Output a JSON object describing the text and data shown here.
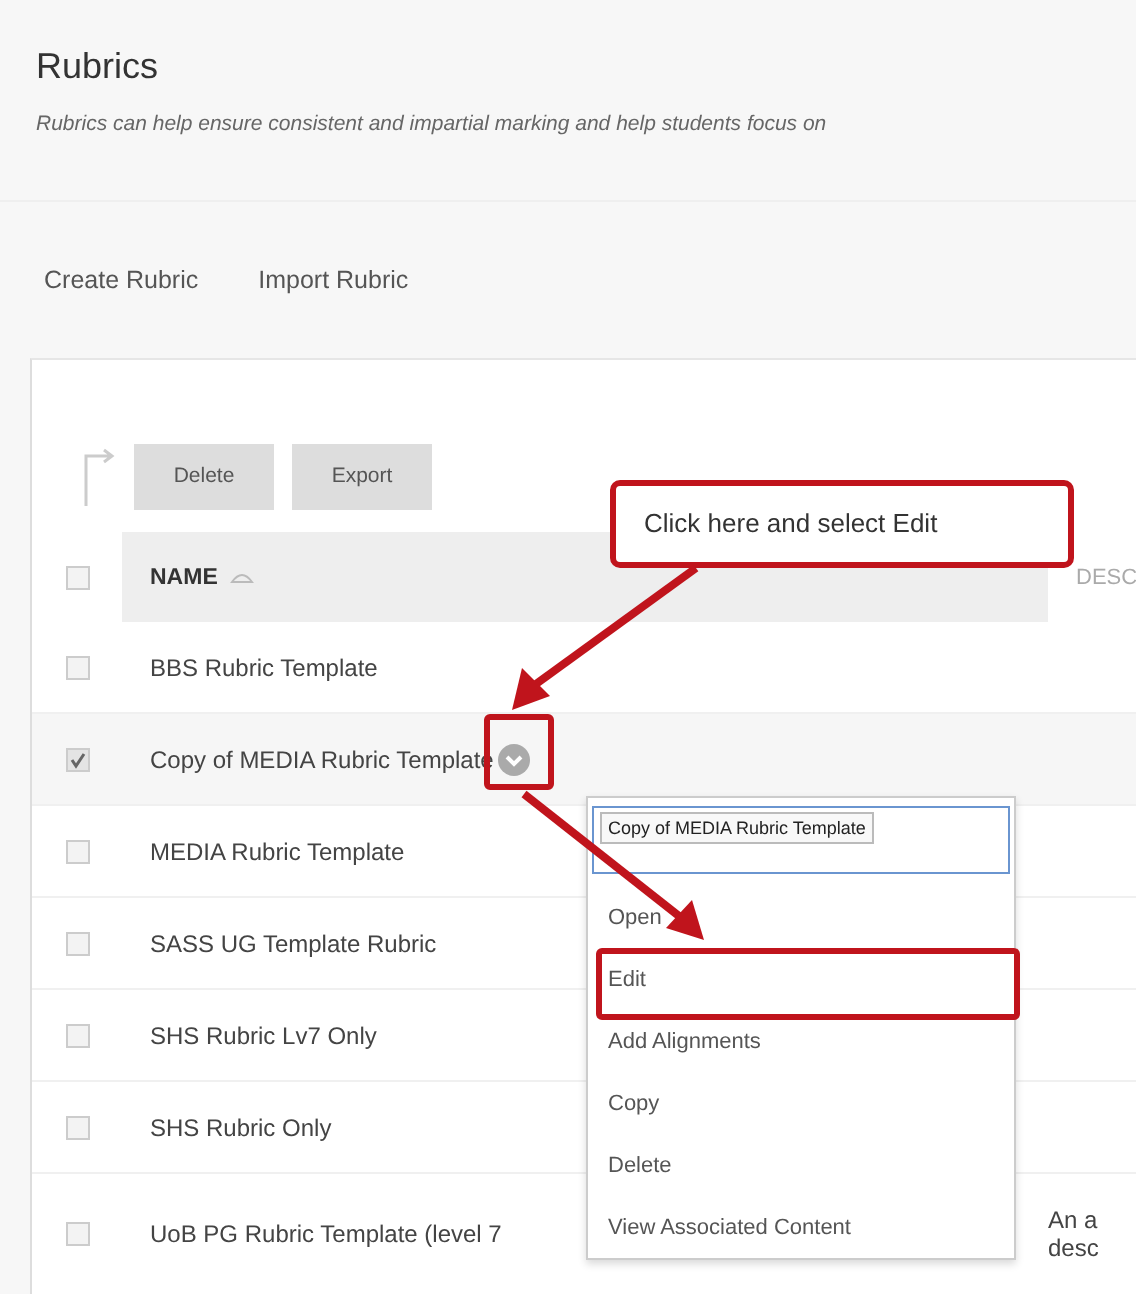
{
  "page": {
    "title": "Rubrics",
    "description": "Rubrics can help ensure consistent and impartial marking and help students focus on"
  },
  "actions": [
    "Create Rubric",
    "Import Rubric"
  ],
  "toolbar": [
    "Delete",
    "Export"
  ],
  "table": {
    "select_all_checked": false,
    "columns": [
      "NAME",
      "DESC"
    ],
    "rows": [
      {
        "name": "BBS Rubric Template",
        "checked": false,
        "selected": false
      },
      {
        "name": "Copy of MEDIA Rubric Template",
        "checked": true,
        "selected": true
      },
      {
        "name": "MEDIA Rubric Template",
        "checked": false,
        "selected": false
      },
      {
        "name": "SASS UG Template Rubric",
        "checked": false,
        "selected": false
      },
      {
        "name": "SHS Rubric Lv7 Only",
        "checked": false,
        "selected": false
      },
      {
        "name": "SHS Rubric Only",
        "checked": false,
        "selected": false
      },
      {
        "name": "UoB PG Rubric Template (level 7",
        "checked": false,
        "selected": false,
        "description": [
          "An a",
          "desc"
        ]
      }
    ]
  },
  "menu": {
    "title": "Copy of MEDIA Rubric Template",
    "items": [
      "Open",
      "Edit",
      "Add Alignments",
      "Copy",
      "Delete",
      "View Associated Content"
    ]
  },
  "callout": "Click here and select Edit"
}
